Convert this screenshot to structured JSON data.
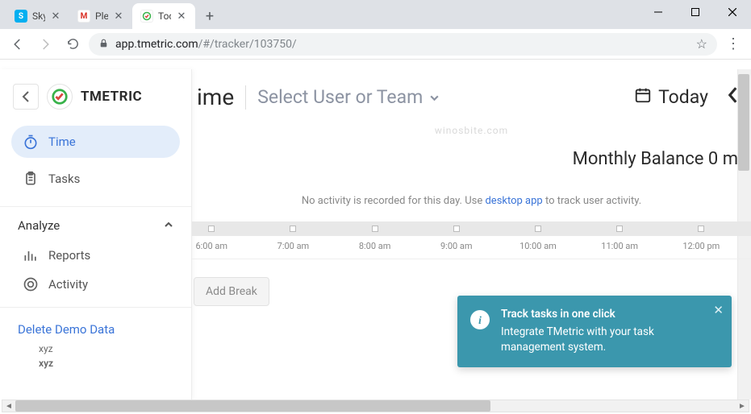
{
  "browser": {
    "tabs": [
      {
        "title": "Skyp",
        "favicon_letter": "S",
        "favicon_bg": "#00aff0"
      },
      {
        "title": "Plea",
        "favicon_letter": "M",
        "favicon_bg": "#ffffff"
      },
      {
        "title": "Toda",
        "favicon_letter": "",
        "favicon_bg": "#ffffff"
      }
    ],
    "url_display_host": "app.tmetric.com",
    "url_display_path": "/#/tracker/103750/"
  },
  "sidebar": {
    "brand": "TMETRIC",
    "items": [
      {
        "label": "Time"
      },
      {
        "label": "Tasks"
      }
    ],
    "analyze_label": "Analyze",
    "analyze_items": [
      {
        "label": "Reports"
      },
      {
        "label": "Activity"
      }
    ],
    "demo_link": "Delete Demo Data",
    "xyz1": "xyz",
    "xyz2": "xyz"
  },
  "main": {
    "heading_suffix": "ime",
    "selector_label": "Select User or Team",
    "today_label": "Today",
    "watermark": "winosbite.com",
    "balance_label": "Monthly Balance",
    "balance_value": "0 m",
    "no_activity_pre": "No activity is recorded for this day. Use ",
    "no_activity_link": "desktop app",
    "no_activity_post": " to track user activity.",
    "timeline_ticks": [
      "6:00 am",
      "7:00 am",
      "8:00 am",
      "9:00 am",
      "10:00 am",
      "11:00 am",
      "12:00 pm"
    ],
    "add_break": "Add Break"
  },
  "toast": {
    "title": "Track tasks in one click",
    "body": "Integrate TMetric with your task management system."
  }
}
